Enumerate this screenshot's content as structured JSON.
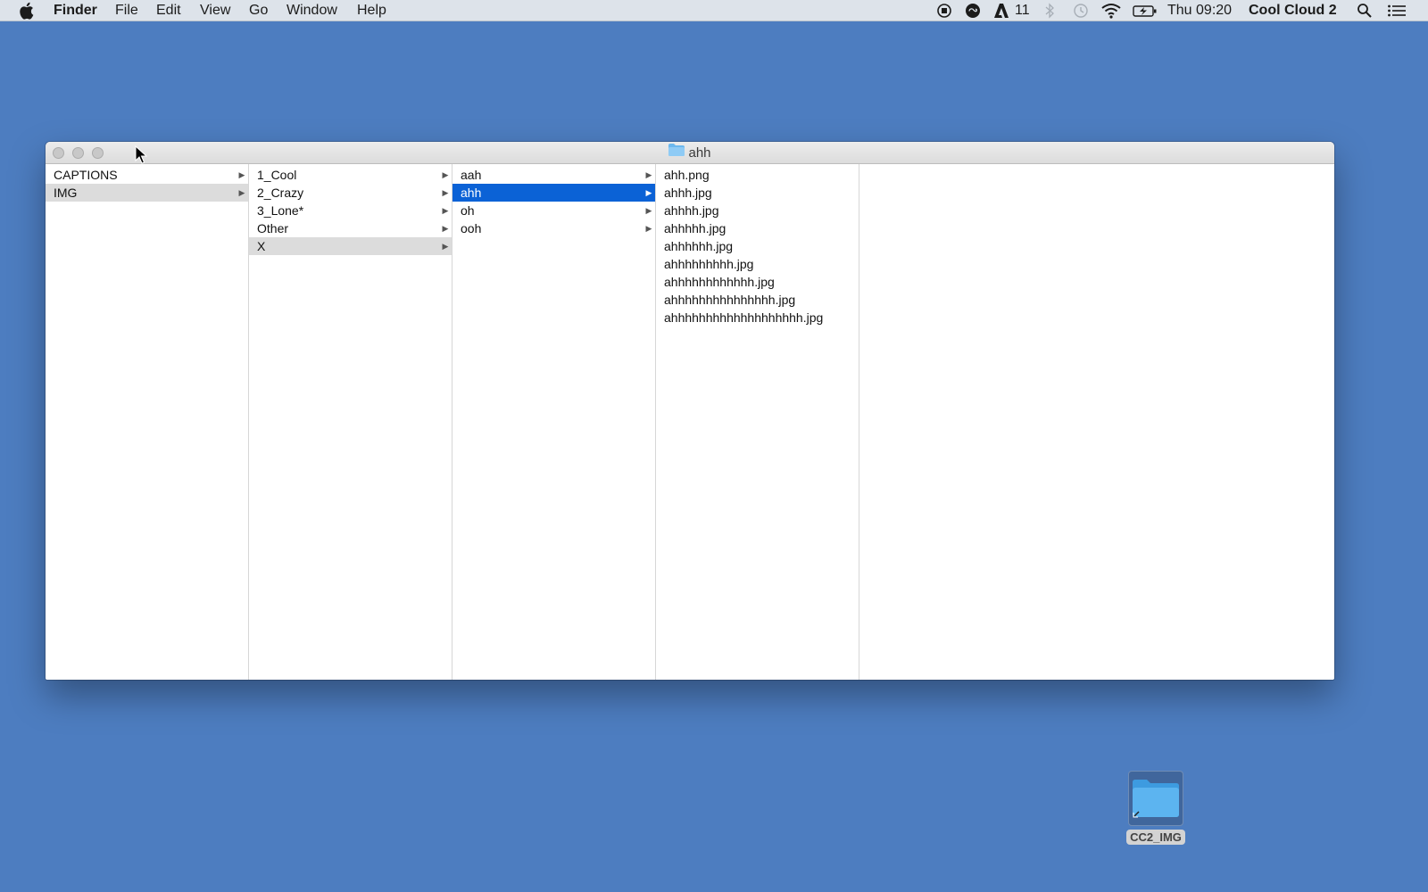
{
  "menubar": {
    "app_name": "Finder",
    "menus": [
      "File",
      "Edit",
      "View",
      "Go",
      "Window",
      "Help"
    ],
    "adobe_count": "11",
    "clock": "Thu 09:20",
    "user": "Cool Cloud 2"
  },
  "window": {
    "title": "ahh",
    "columns": [
      {
        "items": [
          {
            "label": "CAPTIONS",
            "has_children": true,
            "state": "normal"
          },
          {
            "label": "IMG",
            "has_children": true,
            "state": "path"
          }
        ]
      },
      {
        "items": [
          {
            "label": "1_Cool",
            "has_children": true,
            "state": "normal"
          },
          {
            "label": "2_Crazy",
            "has_children": true,
            "state": "normal"
          },
          {
            "label": "3_Lone*",
            "has_children": true,
            "state": "normal"
          },
          {
            "label": "Other",
            "has_children": true,
            "state": "normal"
          },
          {
            "label": "X",
            "has_children": true,
            "state": "path"
          }
        ]
      },
      {
        "items": [
          {
            "label": "aah",
            "has_children": true,
            "state": "normal"
          },
          {
            "label": "ahh",
            "has_children": true,
            "state": "selected"
          },
          {
            "label": "oh",
            "has_children": true,
            "state": "normal"
          },
          {
            "label": "ooh",
            "has_children": true,
            "state": "normal"
          }
        ]
      },
      {
        "items": [
          {
            "label": "ahh.png",
            "has_children": false,
            "state": "normal"
          },
          {
            "label": "ahhh.jpg",
            "has_children": false,
            "state": "normal"
          },
          {
            "label": "ahhhh.jpg",
            "has_children": false,
            "state": "normal"
          },
          {
            "label": "ahhhhh.jpg",
            "has_children": false,
            "state": "normal"
          },
          {
            "label": "ahhhhhh.jpg",
            "has_children": false,
            "state": "normal"
          },
          {
            "label": "ahhhhhhhhh.jpg",
            "has_children": false,
            "state": "normal"
          },
          {
            "label": "ahhhhhhhhhhhh.jpg",
            "has_children": false,
            "state": "normal"
          },
          {
            "label": "ahhhhhhhhhhhhhhh.jpg",
            "has_children": false,
            "state": "normal"
          },
          {
            "label": "ahhhhhhhhhhhhhhhhhhh.jpg",
            "has_children": false,
            "state": "normal"
          }
        ]
      },
      {
        "items": []
      }
    ]
  },
  "desktop": {
    "icon_label": "CC2_IMG"
  },
  "colors": {
    "desktop": "#4d7dc0",
    "selection": "#0b62d6",
    "folder": "#5cb4f0"
  }
}
